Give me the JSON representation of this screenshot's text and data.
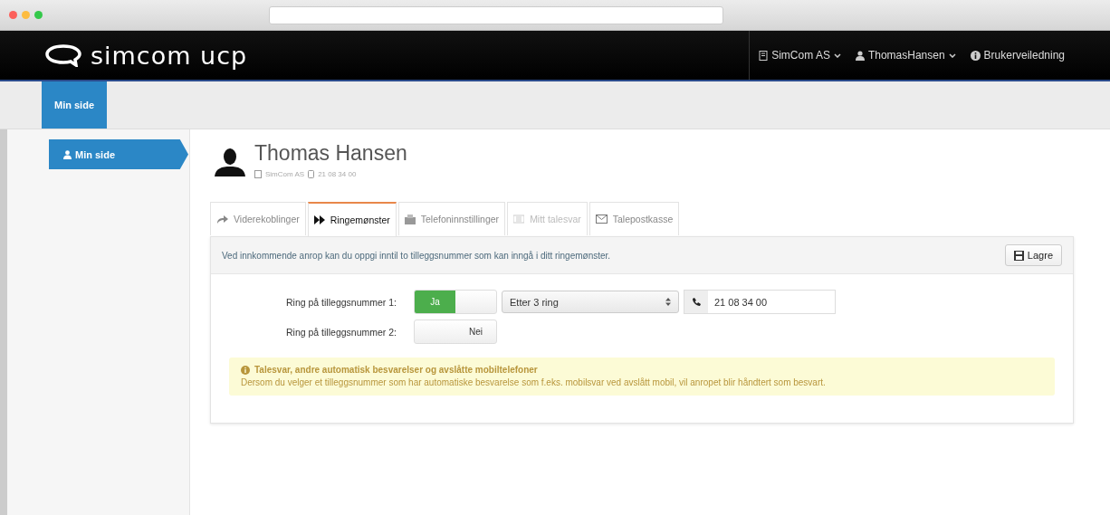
{
  "header": {
    "logo": "simcom ucp",
    "menu": [
      {
        "kind": "company",
        "label": "SimCom AS"
      },
      {
        "kind": "user",
        "label": "ThomasHansen"
      },
      {
        "kind": "help",
        "label": "Brukerveiledning"
      }
    ]
  },
  "nav_tabs": [
    {
      "label": "Min side",
      "selected": true
    }
  ],
  "sidebar": {
    "items": [
      {
        "label": "Min side",
        "selected": true
      }
    ]
  },
  "profile": {
    "name": "Thomas Hansen",
    "company": "SimCom AS",
    "phone": "21 08 34 00"
  },
  "tabs": [
    {
      "label": "Viderekoblinger",
      "kind": "forward",
      "selected": false,
      "disabled": false
    },
    {
      "label": "Ringemønster",
      "kind": "pattern",
      "selected": true,
      "disabled": false
    },
    {
      "label": "Telefoninnstillinger",
      "kind": "phone",
      "selected": false,
      "disabled": false
    },
    {
      "label": "Mitt talesvar",
      "kind": "voicemail",
      "selected": false,
      "disabled": true
    },
    {
      "label": "Talepostkasse",
      "kind": "mail",
      "selected": false,
      "disabled": false
    }
  ],
  "info_text": "Ved innkommende anrop kan du oppgi inntil to tilleggsnummer som kan inngå i ditt ringemønster.",
  "save_button": "Lagre",
  "rows": [
    {
      "label": "Ring på tilleggsnummer 1:",
      "toggle_label": "Ja",
      "on": true,
      "select_value": "Etter 3 ring",
      "phone_value": "21 08 34 00"
    },
    {
      "label": "Ring på tilleggsnummer 2:",
      "toggle_label": "Nei",
      "on": false
    }
  ],
  "warning": {
    "title": "Talesvar, andre automatisk besvarelser og avslåtte mobiltelefoner",
    "text": "Dersom du velger et tilleggsnummer som har automatiske besvarelse som f.eks. mobilsvar ved avslått mobil, vil anropet blir håndtert som besvart."
  }
}
